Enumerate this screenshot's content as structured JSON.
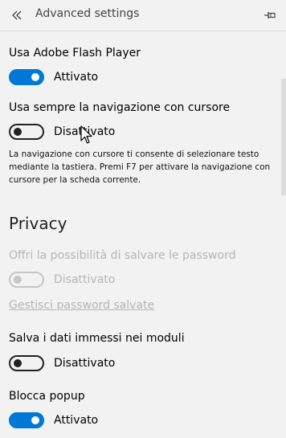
{
  "header": {
    "title": "Advanced settings",
    "back_icon": "double-chevron-left-icon",
    "pin_icon": "pin-icon"
  },
  "settings": {
    "flash": {
      "label": "Usa Adobe Flash Player",
      "state_text": "Attivato",
      "on": true
    },
    "caret": {
      "label": "Usa sempre la navigazione con cursore",
      "state_text": "Disattivato",
      "on": false,
      "description": "La navigazione con cursore ti consente di selezionare testo mediante la tastiera. Premi F7 per attivare la navigazione con cursore per la scheda corrente."
    }
  },
  "privacy": {
    "heading": "Privacy",
    "save_passwords": {
      "label": "Offri la possibilità di salvare le password",
      "state_text": "Disattivato",
      "on": false,
      "disabled": true
    },
    "manage_passwords_link": "Gestisci password salvate",
    "form_entries": {
      "label": "Salva i dati immessi nei moduli",
      "state_text": "Disattivato",
      "on": false
    },
    "block_popups": {
      "label": "Blocca popup",
      "state_text": "Attivato",
      "on": true
    }
  },
  "colors": {
    "accent": "#0078d7",
    "disabled": "#b5b5b5",
    "background": "#f2f2f2"
  }
}
